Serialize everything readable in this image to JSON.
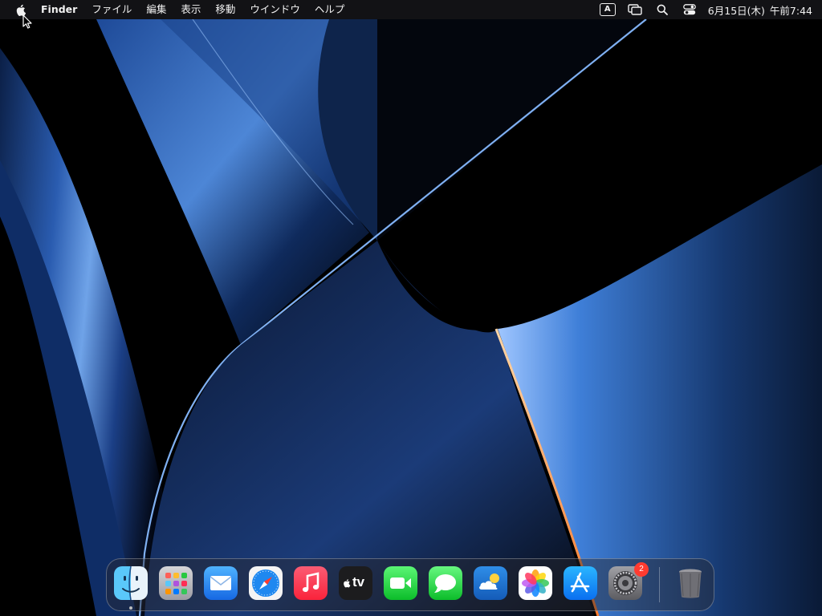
{
  "menubar": {
    "app_name": "Finder",
    "menus": [
      "ファイル",
      "編集",
      "表示",
      "移動",
      "ウインドウ",
      "ヘルプ"
    ],
    "status": {
      "input_indicator": "A",
      "date": "6月15日(木)",
      "time": "午前7:44"
    },
    "icons": [
      "apple-logo-icon",
      "input-source-icon",
      "screen-mirroring-icon",
      "spotlight-search-icon",
      "control-center-icon"
    ]
  },
  "dock": {
    "apps": [
      {
        "name": "Finder",
        "icon": "finder-icon",
        "running": true
      },
      {
        "name": "Launchpad",
        "icon": "launchpad-icon",
        "running": false
      },
      {
        "name": "Mail",
        "icon": "mail-icon",
        "running": false
      },
      {
        "name": "Safari",
        "icon": "safari-icon",
        "running": false
      },
      {
        "name": "Music",
        "icon": "music-icon",
        "running": false
      },
      {
        "name": "TV",
        "icon": "tv-icon",
        "label": "tv",
        "running": false
      },
      {
        "name": "FaceTime",
        "icon": "facetime-icon",
        "running": false
      },
      {
        "name": "Messages",
        "icon": "messages-icon",
        "running": false
      },
      {
        "name": "Weather",
        "icon": "weather-icon",
        "running": false
      },
      {
        "name": "Photos",
        "icon": "photos-icon",
        "running": false
      },
      {
        "name": "App Store",
        "icon": "app-store-icon",
        "running": false
      },
      {
        "name": "System Settings",
        "icon": "system-settings-icon",
        "running": false,
        "badge": "2"
      }
    ],
    "trash": {
      "name": "Trash",
      "icon": "trash-icon"
    }
  },
  "colors": {
    "menubar_bg": "#16161a",
    "accent_blue": "#3f7fd8",
    "badge_red": "#ff3b30"
  }
}
